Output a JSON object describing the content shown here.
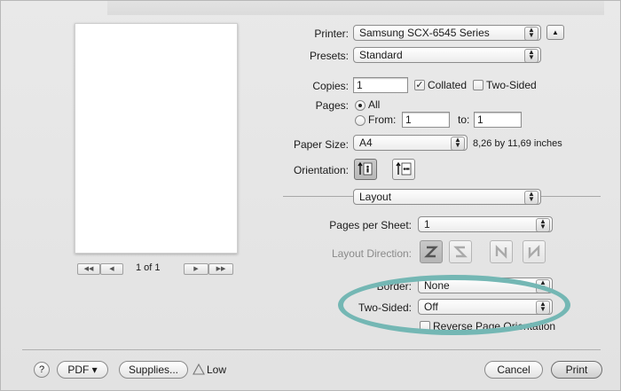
{
  "printer": {
    "label": "Printer:",
    "value": "Samsung SCX-6545 Series"
  },
  "presets": {
    "label": "Presets:",
    "value": "Standard"
  },
  "copies": {
    "label": "Copies:",
    "value": "1",
    "collated_label": "Collated",
    "collated_checked": true,
    "two_sided_label": "Two-Sided",
    "two_sided_checked": false
  },
  "pages": {
    "label": "Pages:",
    "all_label": "All",
    "from_label": "From:",
    "from_value": "1",
    "to_label": "to:",
    "to_value": "1",
    "selected": "All"
  },
  "paper_size": {
    "label": "Paper Size:",
    "value": "A4",
    "dimensions": "8,26 by 11,69 inches"
  },
  "orientation": {
    "label": "Orientation:",
    "selected": "portrait"
  },
  "section": {
    "value": "Layout"
  },
  "pages_per_sheet": {
    "label": "Pages per Sheet:",
    "value": "1"
  },
  "layout_direction": {
    "label": "Layout Direction:",
    "options": [
      "Z",
      "S",
      "N-reverse",
      "N"
    ],
    "selected": "Z"
  },
  "border": {
    "label": "Border:",
    "value": "None"
  },
  "two_sided": {
    "label": "Two-Sided:",
    "value": "Off"
  },
  "reverse_page": {
    "label": "Reverse Page Orientation",
    "checked": false
  },
  "preview": {
    "page_indicator": "1 of 1"
  },
  "bottom": {
    "help_label": "?",
    "pdf_label": "PDF ▾",
    "supplies_label": "Supplies...",
    "low_label": "Low",
    "cancel_label": "Cancel",
    "print_label": "Print"
  },
  "colors": {
    "highlight_ring": "#74b7b4",
    "dialog_bg": "#e6e6e6"
  }
}
